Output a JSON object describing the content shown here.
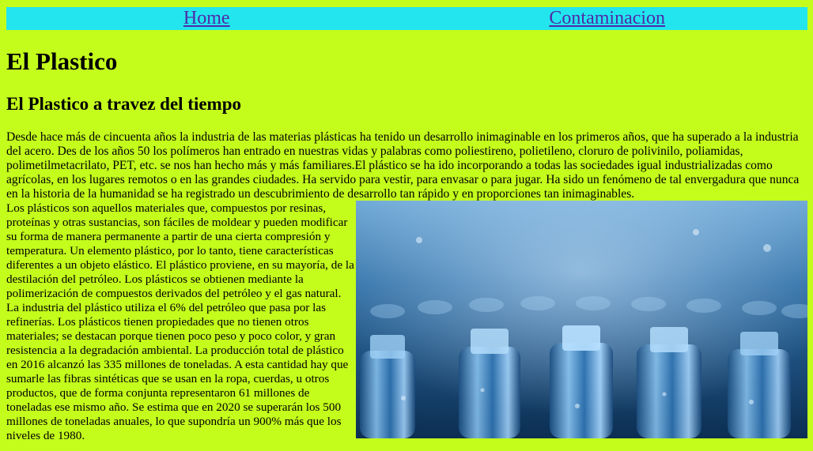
{
  "nav": {
    "home_label": "Home",
    "contaminacion_label": "Contaminacion",
    "background": "#22e5ee",
    "link_color": "#4d2aa6"
  },
  "page": {
    "background": "#c4fc1c",
    "title": "El Plastico",
    "subtitle": "El Plastico a travez del tiempo",
    "intro_paragraph": "Desde hace más de cincuenta años la industria de las materias plásticas ha tenido un desarrollo inimaginable en los primeros años, que ha superado a la industria del acero. Des de los años 50 los polímeros han entrado en nuestras vidas y palabras como poliestireno, polietileno, cloruro de polivinilo, poliamidas, polimetilmetacrilato, PET, etc. se nos han hecho más y más familiares.El plástico se ha ido incorporando a todas las sociedades igual industrializadas como agrícolas, en los lugares remotos o en las grandes ciudades. Ha servido para vestir, para envasar o para jugar. Ha sido un fenómeno de tal envergadura que nunca en la historia de la humanidad se ha registrado un descubrimiento de desarrollo tan rápido y en proporciones tan inimaginables.",
    "body_paragraph": "Los plásticos son aquellos materiales que, compuestos por resinas, proteínas y otras sustancias, son fáciles de moldear y pueden modificar su forma de manera permanente a partir de una cierta compresión y temperatura. Un elemento plástico, por lo tanto, tiene características diferentes a un objeto elástico. El plástico proviene, en su mayoría, de la destilación del petróleo. Los plásticos se obtienen mediante la polimerización de compuestos derivados del petróleo y el gas natural. La industria del plástico utiliza el 6% del petróleo que pasa por las refinerías. Los plásticos tienen propiedades que no tienen otros materiales; se destacan porque tienen poco peso y poco color, y gran resistencia a la degradación ambiental. La producción total de plástico en 2016 alcanzó las 335 millones de toneladas. A esta cantidad hay que sumarle las fibras sintéticas que se usan en la ropa, cuerdas, u otros productos, que de forma conjunta representaron 61 millones de toneladas ese mismo año. Se estima que en 2020 se superarán los 500 millones de toneladas anuales, lo que supondría un 900% más que los niveles de 1980.",
    "image_subject": "plastic-bottles-photo"
  }
}
